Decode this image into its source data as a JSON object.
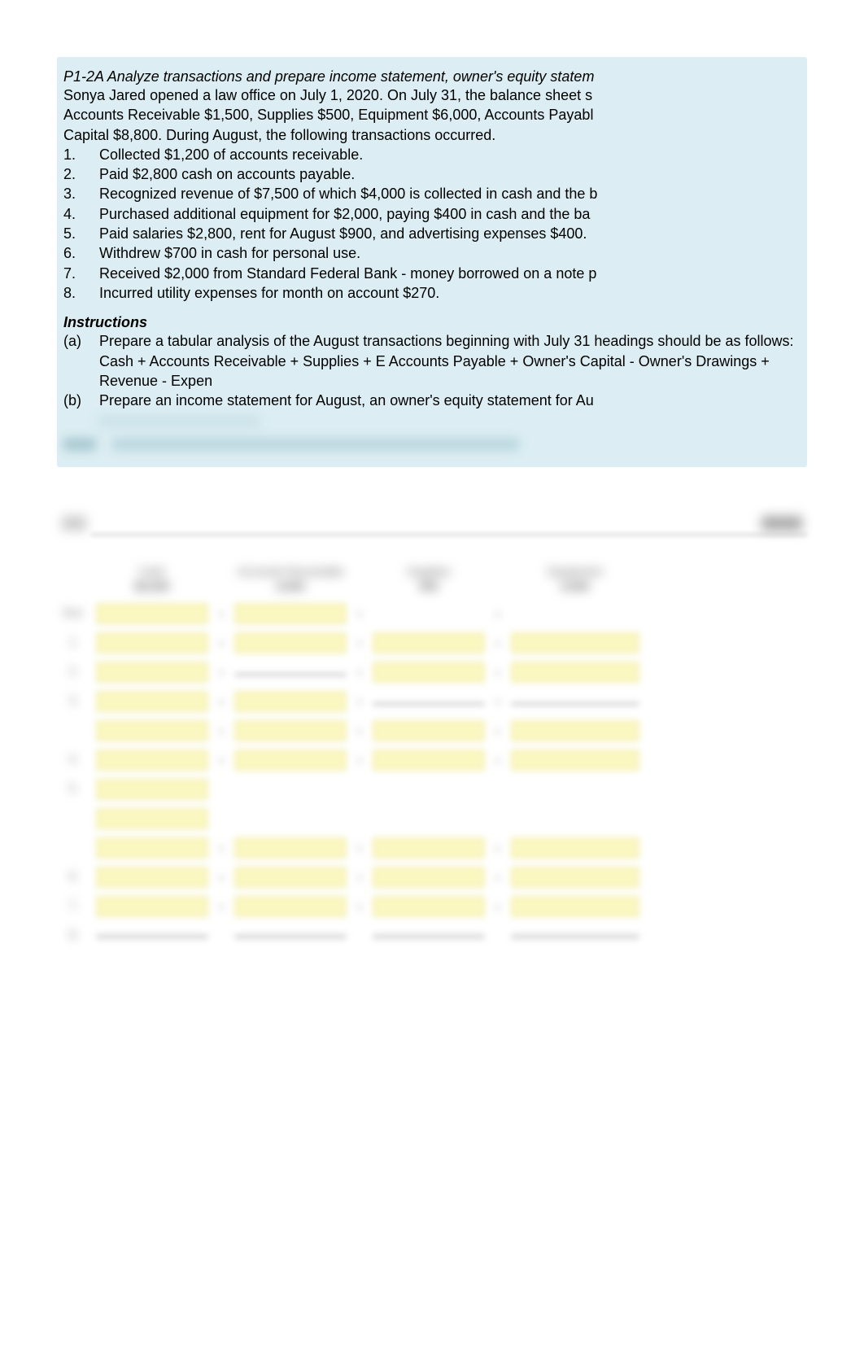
{
  "problem": {
    "code_title": "P1-2A  Analyze transactions and prepare income statement, owner's equity statem",
    "intro_line1": "Sonya Jared opened a law office on July 1, 2020.  On July 31, the balance sheet s",
    "intro_line2": "Accounts Receivable $1,500, Supplies $500, Equipment $6,000, Accounts Payabl",
    "intro_line3": "Capital $8,800.  During August, the following transactions occurred.",
    "transactions": [
      {
        "num": "1.",
        "text": "Collected $1,200 of accounts receivable."
      },
      {
        "num": "2.",
        "text": "Paid $2,800 cash on accounts payable."
      },
      {
        "num": "3.",
        "text": "Recognized revenue of $7,500 of which $4,000 is collected in cash and the b"
      },
      {
        "num": "4.",
        "text": "Purchased additional equipment for $2,000, paying $400 in cash and the ba"
      },
      {
        "num": "5.",
        "text": "Paid salaries $2,800, rent for August $900, and advertising expenses $400."
      },
      {
        "num": "6.",
        "text": "Withdrew $700 in cash for personal use."
      },
      {
        "num": "7.",
        "text": "Received $2,000 from Standard Federal Bank - money borrowed on a note p"
      },
      {
        "num": "8.",
        "text": "Incurred utility expenses for month on account $270."
      }
    ],
    "instructions_heading": "Instructions",
    "instructions": [
      {
        "label": "(a)",
        "text": "Prepare a tabular analysis of the August transactions beginning with July 31 headings should be as follows:  Cash + Accounts Receivable + Supplies + E Accounts Payable + Owner's Capital - Owner's Drawings + Revenue - Expen"
      },
      {
        "label": "(b)",
        "text": "Prepare an income statement for August, an owner's equity statement for Au"
      }
    ]
  },
  "table": {
    "columns": [
      "Cash",
      "Accounts Receivable",
      "Supplies",
      "Equipment"
    ],
    "row_labels": [
      "Bal.",
      "1.",
      "2.",
      "3.",
      "4.",
      "5.",
      "6.",
      "7.",
      "8."
    ]
  }
}
